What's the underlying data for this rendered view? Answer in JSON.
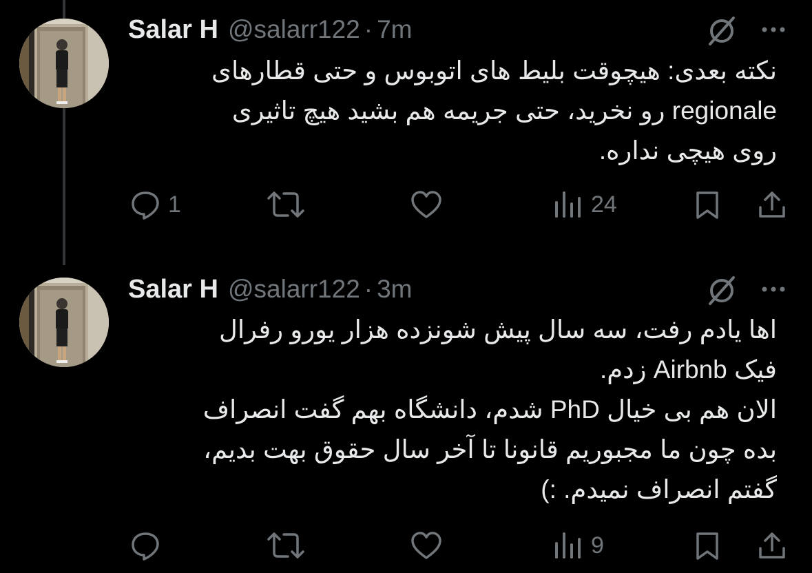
{
  "tweets": [
    {
      "display_name": "Salar H",
      "handle": "@salarr122",
      "separator": "·",
      "time": "7m",
      "text": "نکته بعدی: هیچوقت بلیط های اتوبوس و حتی قطارهای\nregionale رو نخرید، حتی جریمه هم بشید هیچ تاثیری\nروی هیچی نداره.",
      "replies": "1",
      "reposts": "",
      "likes": "",
      "views": "24"
    },
    {
      "display_name": "Salar H",
      "handle": "@salarr122",
      "separator": "·",
      "time": "3m",
      "text": "اها یادم رفت، سه سال پیش شونزده هزار یورو رفرال\nفیک Airbnb زدم.\nالان هم بی خیال PhD شدم، دانشگاه بهم گفت انصراف\nبده چون ما مجبوریم قانونا تا آخر سال حقوق بهت بدیم،\nگفتم انصراف نمیدم. :)",
      "replies": "",
      "reposts": "",
      "likes": "",
      "views": "9"
    }
  ],
  "icons": {
    "reply": "speech-bubble-icon",
    "repost": "repost-arrows-icon",
    "like": "heart-icon",
    "views": "bar-chart-icon",
    "bookmark": "bookmark-icon",
    "share": "share-upload-icon",
    "grok": "grok-slash-icon",
    "more": "ellipsis-icon"
  },
  "colors": {
    "background": "#000000",
    "text_primary": "#e7e9ea",
    "text_secondary": "#71767b",
    "thread_line": "#333639"
  }
}
